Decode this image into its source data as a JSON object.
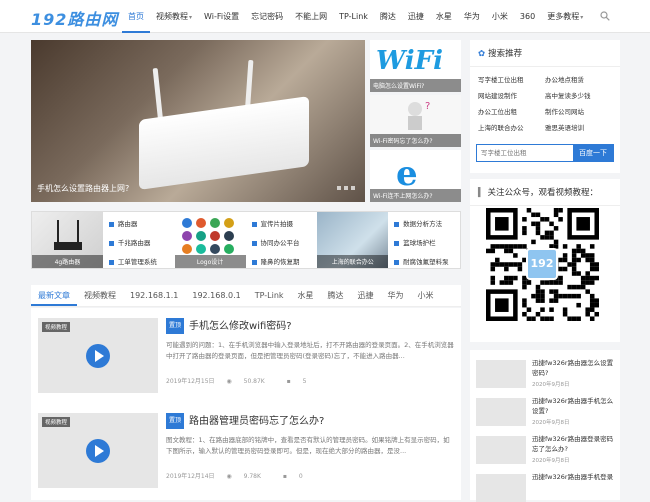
{
  "brand": {
    "logo": "192路由网"
  },
  "nav": [
    {
      "label": "首页",
      "active": true,
      "dropdown": false
    },
    {
      "label": "视频教程",
      "active": false,
      "dropdown": true
    },
    {
      "label": "Wi-Fi设置",
      "active": false,
      "dropdown": false
    },
    {
      "label": "忘记密码",
      "active": false,
      "dropdown": false
    },
    {
      "label": "不能上网",
      "active": false,
      "dropdown": false
    },
    {
      "label": "TP-Link",
      "active": false,
      "dropdown": false
    },
    {
      "label": "腾达",
      "active": false,
      "dropdown": false
    },
    {
      "label": "迅捷",
      "active": false,
      "dropdown": false
    },
    {
      "label": "水星",
      "active": false,
      "dropdown": false
    },
    {
      "label": "华为",
      "active": false,
      "dropdown": false
    },
    {
      "label": "小米",
      "active": false,
      "dropdown": false
    },
    {
      "label": "360",
      "active": false,
      "dropdown": false
    },
    {
      "label": "更多教程",
      "active": false,
      "dropdown": true
    }
  ],
  "slider": {
    "caption": "手机怎么设置路由器上网?"
  },
  "side_thumbs": [
    {
      "caption": "电脑怎么设置WiFi?",
      "logo": "WiFi"
    },
    {
      "caption": "Wi-Fi密码忘了怎么办?"
    },
    {
      "caption": "Wi-Fi连不上网怎么办?",
      "logo": "e"
    }
  ],
  "grid": {
    "cells": [
      {
        "caption": "4g路由器"
      },
      {
        "caption": "Logo设计"
      },
      {
        "caption": "上海的联合办公"
      },
      {
        "caption": "耐腐蚀氟塑料泵"
      }
    ],
    "lists": [
      [
        "路由器",
        "千兆路由器",
        "工单管理系统"
      ],
      [
        "宣传片拍摄",
        "协同办公平台",
        "隆鼻的恢复期"
      ],
      [
        "数据分析方法",
        "篮球场护栏",
        "耐腐蚀氟塑料泵"
      ]
    ]
  },
  "tabs": [
    {
      "label": "最新文章",
      "active": true
    },
    {
      "label": "视频教程",
      "active": false
    },
    {
      "label": "192.168.1.1",
      "active": false
    },
    {
      "label": "192.168.0.1",
      "active": false
    },
    {
      "label": "TP-Link",
      "active": false
    },
    {
      "label": "水星",
      "active": false
    },
    {
      "label": "腾达",
      "active": false
    },
    {
      "label": "迅捷",
      "active": false
    },
    {
      "label": "华为",
      "active": false
    },
    {
      "label": "小米",
      "active": false
    }
  ],
  "articles": [
    {
      "tag": "视频教程",
      "badge": "置顶",
      "title": "手机怎么修改wifi密码?",
      "excerpt": "可能遇到的问题：1、在手机浏览器中输入登录地址后，打不开路由器的登录页面。2、在手机浏览器中打开了路由器的登录页面，但是把管理员密码(登录密码)忘了，不能进入路由器...",
      "date": "2019年12月15日",
      "views": "50.87K",
      "comments": "5"
    },
    {
      "tag": "视频教程",
      "badge": "置顶",
      "title": "路由器管理员密码忘了怎么办?",
      "excerpt": "图文教程：1、在路由器底部的铭牌中，查看是否有默认的管理员密码。如果铭牌上有显示密码，如下图所示，输入默认的管理员密码登录即可。但是，现在绝大部分的路由器，是没...",
      "date": "2019年12月14日",
      "views": "9.78K",
      "comments": "0"
    }
  ],
  "sidebar": {
    "search_title": "搜索推荐",
    "keywords": [
      "写字楼工位出租",
      "办公地点租赁",
      "网站建设制作",
      "高中复读多少钱",
      "办公工位出租",
      "制作公司网站",
      "上海的联合办公",
      "雅思英语培训"
    ],
    "search_placeholder": "写字楼工位出租",
    "search_button": "百度一下",
    "wechat_title": "关注公众号，观看视频教程：",
    "qr_logo": "192",
    "recent": [
      {
        "title": "迅捷fw326r路由器怎么设置密码?",
        "date": "2020年9月8日"
      },
      {
        "title": "迅捷fw326r路由器手机怎么设置?",
        "date": "2020年9月8日"
      },
      {
        "title": "迅捷fw326r路由器登录密码忘了怎么办?",
        "date": "2020年9月8日"
      },
      {
        "title": "迅捷fw326r路由器手机登录",
        "date": ""
      }
    ]
  },
  "colors": {
    "accent": "#2e7ad6",
    "logo": "#3d8fe0"
  }
}
